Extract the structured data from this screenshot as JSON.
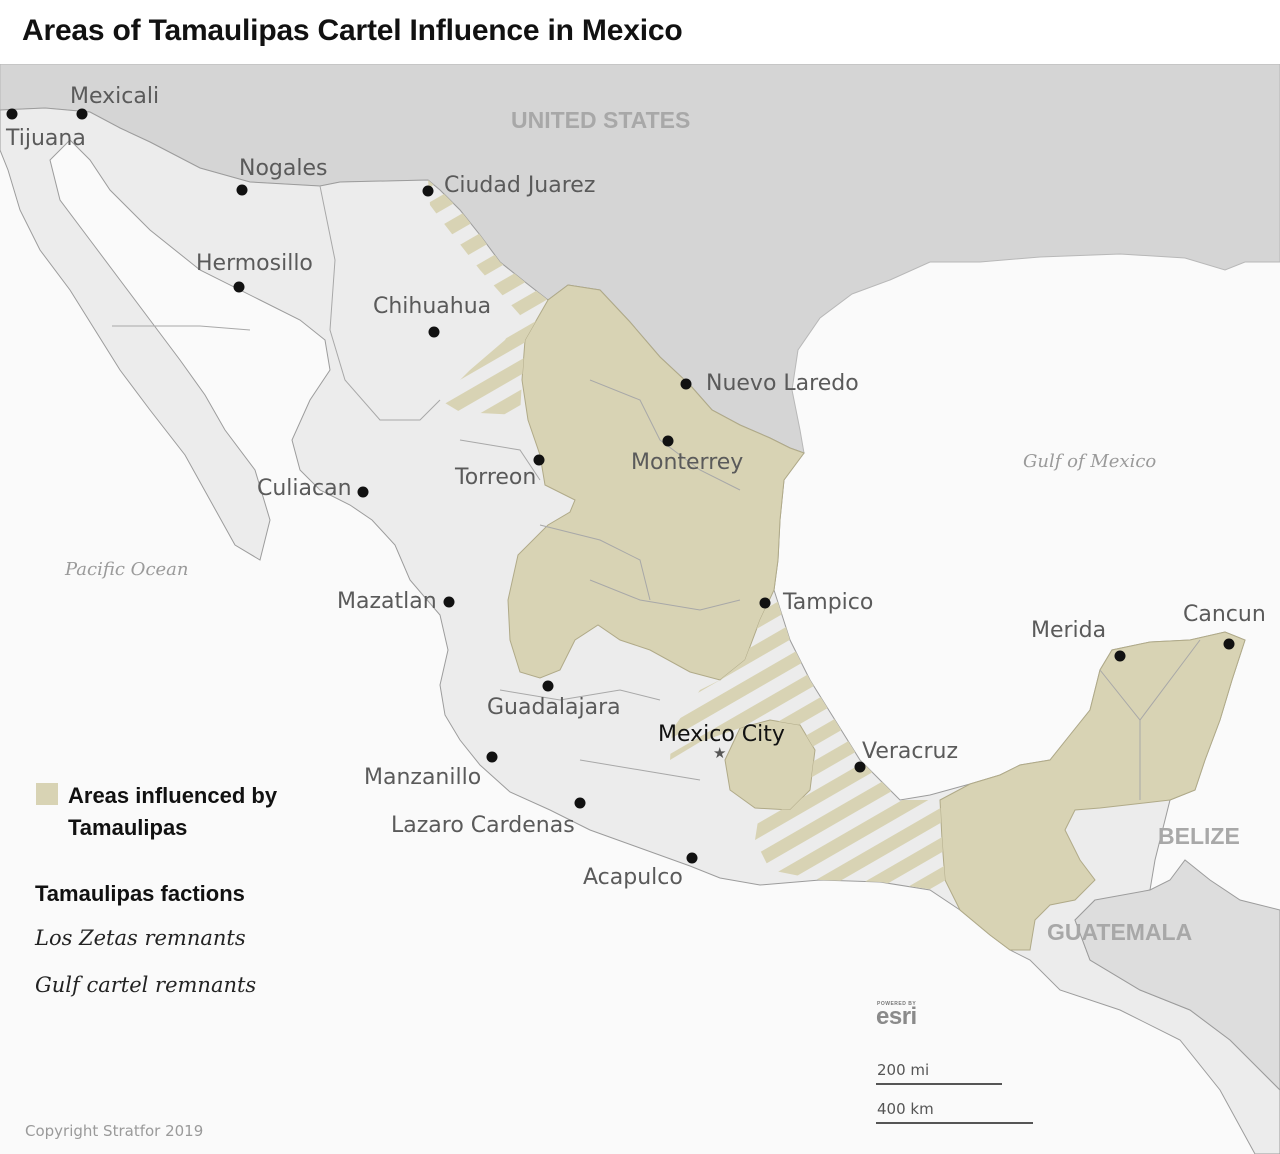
{
  "title": "Areas of Tamaulipas Cartel Influence in Mexico",
  "colors": {
    "land_us": "#d5d5d5",
    "land_mexico": "#ececec",
    "water": "#fafafa",
    "influence": "#d8d3b4",
    "city_dot": "#111111",
    "border": "#8c8c8c"
  },
  "countries": {
    "united_states": "UNITED STATES",
    "belize": "BELIZE",
    "guatemala": "GUATEMALA"
  },
  "water_bodies": {
    "gulf": "Gulf of Mexico",
    "pacific": "Pacific Ocean"
  },
  "cities": {
    "tijuana": "Tijuana",
    "mexicali": "Mexicali",
    "nogales": "Nogales",
    "ciudad_juarez": "Ciudad Juarez",
    "hermosillo": "Hermosillo",
    "chihuahua": "Chihuahua",
    "nuevo_laredo": "Nuevo Laredo",
    "monterrey": "Monterrey",
    "torreon": "Torreon",
    "culiacan": "Culiacan",
    "mazatlan": "Mazatlan",
    "tampico": "Tampico",
    "guadalajara": "Guadalajara",
    "mexico_city": "Mexico City",
    "manzanillo": "Manzanillo",
    "veracruz": "Veracruz",
    "lazaro_cardenas": "Lazaro Cardenas",
    "acapulco": "Acapulco",
    "merida": "Merida",
    "cancun": "Cancun"
  },
  "legend": {
    "influence_label": "Areas influenced by Tamaulipas",
    "factions_heading": "Tamaulipas factions",
    "factions": [
      "Los Zetas remnants",
      "Gulf cartel remnants"
    ]
  },
  "attribution": {
    "powered_by": "POWERED BY",
    "esri": "esri"
  },
  "scale": {
    "miles": "200 mi",
    "kilometers": "400 km"
  },
  "copyright": "Copyright Stratfor 2019"
}
